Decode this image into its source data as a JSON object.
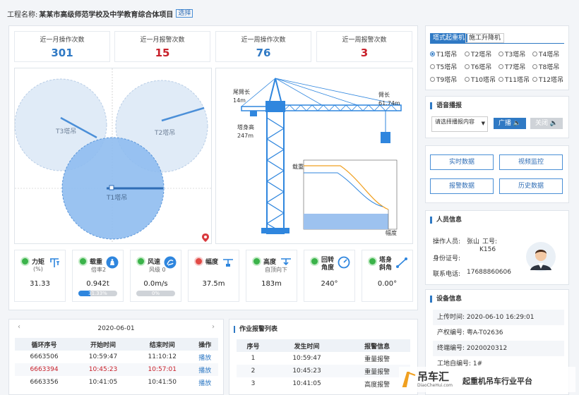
{
  "header": {
    "label": "工程名称:",
    "project": "某某市高级师范学校及中学教育综合体项目",
    "select": "选择"
  },
  "stats": [
    {
      "title": "近一月操作次数",
      "value": "301",
      "color": "blue"
    },
    {
      "title": "近一月报警次数",
      "value": "15",
      "color": "red"
    },
    {
      "title": "近一周操作次数",
      "value": "76",
      "color": "blue"
    },
    {
      "title": "近一周报警次数",
      "value": "3",
      "color": "red"
    }
  ],
  "map": {
    "cranes": [
      "T3塔吊",
      "T2塔吊",
      "T1塔吊"
    ]
  },
  "crane_diagram": {
    "tail_label": "尾臂长",
    "tail_value": "14m",
    "jib_label": "臂长",
    "jib_value": "61.74m",
    "height_label": "塔身高",
    "height_value": "247m",
    "load_label": "载重",
    "amplitude_label": "幅度"
  },
  "sensors": [
    {
      "name": "力矩",
      "sub": "(%)",
      "value": "31.33",
      "status": "ok",
      "icon": "torque-icon"
    },
    {
      "name": "载重",
      "sub": "倍率2",
      "value": "0.942t",
      "status": "ok",
      "icon": "weight-icon",
      "bar": 0.3133,
      "bar_label": "31.33%"
    },
    {
      "name": "风速",
      "sub": "风级 0",
      "value": "0.0m/s",
      "status": "ok",
      "icon": "wind-icon",
      "bar": 0,
      "bar_label": "0%"
    },
    {
      "name": "幅度",
      "sub": "",
      "value": "37.5m",
      "status": "warn",
      "icon": "amplitude-icon"
    },
    {
      "name": "高度",
      "sub": "自顶向下",
      "value": "183m",
      "status": "ok",
      "icon": "height-icon"
    },
    {
      "name": "回转角度",
      "sub": "",
      "value": "240°",
      "status": "ok",
      "icon": "rotation-icon"
    },
    {
      "name": "塔身斜角",
      "sub": "",
      "value": "0.00°",
      "status": "ok",
      "icon": "tilt-icon"
    }
  ],
  "cycle_table": {
    "date": "2020-06-01",
    "headers": [
      "循环序号",
      "开始时间",
      "结束时间",
      "操作"
    ],
    "rows": [
      [
        "6663506",
        "10:59:47",
        "11:10:12",
        "播放"
      ],
      [
        "6663394",
        "10:45:23",
        "10:57:01",
        "播放"
      ],
      [
        "6663356",
        "10:41:05",
        "10:41:50",
        "播放"
      ]
    ]
  },
  "alarm_table": {
    "title": "作业报警列表",
    "headers": [
      "序号",
      "发生时间",
      "报警信息"
    ],
    "rows": [
      [
        "1",
        "10:59:47",
        "重量报警"
      ],
      [
        "2",
        "10:45:23",
        "重量报警"
      ],
      [
        "3",
        "10:41:05",
        "高度报警"
      ]
    ]
  },
  "crane_select": {
    "tabs": [
      "塔式起重机",
      "施工升降机"
    ],
    "options": [
      "T1塔吊",
      "T2塔吊",
      "T3塔吊",
      "T4塔吊",
      "T5塔吊",
      "T6塔吊",
      "T7塔吊",
      "T8塔吊",
      "T9塔吊",
      "T10塔吊",
      "T11塔吊",
      "T12塔吊"
    ]
  },
  "voice": {
    "title": "语音播报",
    "placeholder": "请选择播报内容",
    "broadcast": "广播",
    "close": "关闭"
  },
  "data_buttons": [
    "实时数据",
    "视频监控",
    "报警数据",
    "历史数据"
  ],
  "person": {
    "title": "人员信息",
    "operator_label": "操作人员:",
    "operator": "张山",
    "work_no_label": "工号:",
    "work_no": "K156",
    "id_label": "身份证号:",
    "id": "",
    "phone_label": "联系电话:",
    "phone": "17688860606"
  },
  "device": {
    "title": "设备信息",
    "rows": [
      {
        "label": "上传时间:",
        "value": "2020-06-10 16:29:01"
      },
      {
        "label": "产权编号:",
        "value": "粤A-T02636"
      },
      {
        "label": "终端编号:",
        "value": "2020020312"
      },
      {
        "label": "工地自编号:",
        "value": "1#"
      }
    ]
  },
  "watermark": {
    "name": "吊车汇",
    "site": "DiaoCheHui.com",
    "slogan": "起重机吊车行业平台"
  }
}
